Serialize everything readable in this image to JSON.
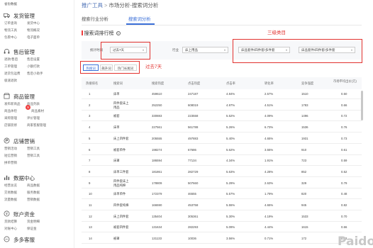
{
  "sidebar": {
    "top_label": "省份数据",
    "sections": [
      {
        "title": "发货管理",
        "icon": "truck-icon",
        "links": [
          "订单查询",
          "发货中心",
          "物流工具",
          "物流概况",
          "包裹中心",
          "电子面单"
        ]
      },
      {
        "title": "售后管理",
        "icon": "headset-icon",
        "links": [
          "退款/售后",
          "售后设置",
          "工单管理",
          "小额打款",
          "退货包运费",
          "售后小助手",
          "极速退款",
          ""
        ]
      },
      {
        "title": "商品管理",
        "icon": "shop-icon",
        "links": [
          "发布新商品",
          "商品列表",
          "商品体检",
          "商品素材",
          "采购管理",
          "评价管理",
          "店铺装修",
          "商家客服管理"
        ],
        "badge": "9"
      },
      {
        "title": "店铺营销",
        "icon": "flag-icon",
        "links": [
          "营销活动",
          "营销工具",
          "短信营销",
          "营销工具",
          "拼单营销",
          ""
        ]
      },
      {
        "title": "数据中心",
        "icon": "chart-icon",
        "links": [
          "经营总览",
          "商品数据",
          "交易数据",
          "服务数据",
          "流量数据",
          "营销数据"
        ]
      },
      {
        "title": "账户资金",
        "icon": "wallet-icon",
        "links": [
          "货款结算",
          "资金明细",
          "对账中心",
          "保证金",
          ""
        ]
      },
      {
        "title": "多多客服",
        "icon": "chat-icon",
        "links": []
      }
    ]
  },
  "breadcrumb": {
    "root": "推广工具",
    "sep": ">",
    "current": "市场分析-搜索词分析"
  },
  "tabs": [
    "搜索行业分析",
    "搜索词分析"
  ],
  "section_title": "搜索词排行榜",
  "notes": {
    "category": "三级类目",
    "days": "过去7天"
  },
  "filters": {
    "period_label": "统计时间",
    "period_value": "过去7天",
    "industry_label": "行业",
    "industry_value": "床上用品",
    "cat1_value": "床品套件/四件套/多件套",
    "cat2_value": "床品套件/四件套/多件套"
  },
  "subtabs": [
    "热搜词",
    "飙升词",
    "热门长尾词"
  ],
  "table": {
    "headers": [
      "热搜排名",
      "搜索词",
      "搜索热度",
      "点击热度",
      "点击率",
      "转化率",
      "竞争强度",
      "市场平均出价(元)"
    ],
    "rows": [
      [
        "1",
        "床单",
        "459610",
        "247187",
        "4.84%",
        "2.57%",
        "1510",
        "0.50"
      ],
      [
        "2",
        "四件套床上用品",
        "252250",
        "608019",
        "4.97%",
        "4.51%",
        "1783",
        "0.66"
      ],
      [
        "3",
        "被套",
        "330883",
        "223558",
        "5.52%",
        "4.09%",
        "1496",
        "0.72"
      ],
      [
        "4",
        "床单",
        "227561",
        "561788",
        "5.26%",
        "6.73%",
        "1536",
        "0.76"
      ],
      [
        "5",
        "床上四件套",
        "205555",
        "497883",
        "5.40%",
        "4.65%",
        "1931",
        "0.73"
      ],
      [
        "6",
        "被套单件",
        "198274",
        "67686",
        "5.62%",
        "3.55%",
        "910",
        "0.61"
      ],
      [
        "7",
        "床罩",
        "186594",
        "77134",
        "4.34%",
        "1.91%",
        "723",
        "0.59"
      ],
      [
        "8",
        "床单三件套",
        "181861",
        "282729",
        "5.63%",
        "4.28%",
        "852",
        "0.52"
      ],
      [
        "9",
        "四件套床上用品纯棉",
        "178809",
        "507660",
        "5.29%",
        "2.63%",
        "329",
        "0.79"
      ],
      [
        "10",
        "床单单件",
        "172379",
        "46555",
        "5.57%",
        "1.79%",
        "820",
        "0.48"
      ],
      [
        "11",
        "四件套纯棉",
        "166590",
        "453758",
        "5.55%",
        "4.65%",
        "945",
        "0.82"
      ],
      [
        "12",
        "床上四件套",
        "135404",
        "305361",
        "5.30%",
        "4.19%",
        "1533",
        "0.70"
      ],
      [
        "13",
        "被套四件套",
        "131634",
        "282293",
        "5.09%",
        "4.44%",
        "1615",
        "0.66"
      ],
      [
        "14",
        "被罩",
        "131133",
        "10036",
        "3.56%",
        "0.71%",
        "172",
        "0.52"
      ]
    ]
  },
  "watermark": "Paido",
  "colors": {
    "accent": "#3a6fd8",
    "highlight": "#e2322f"
  }
}
